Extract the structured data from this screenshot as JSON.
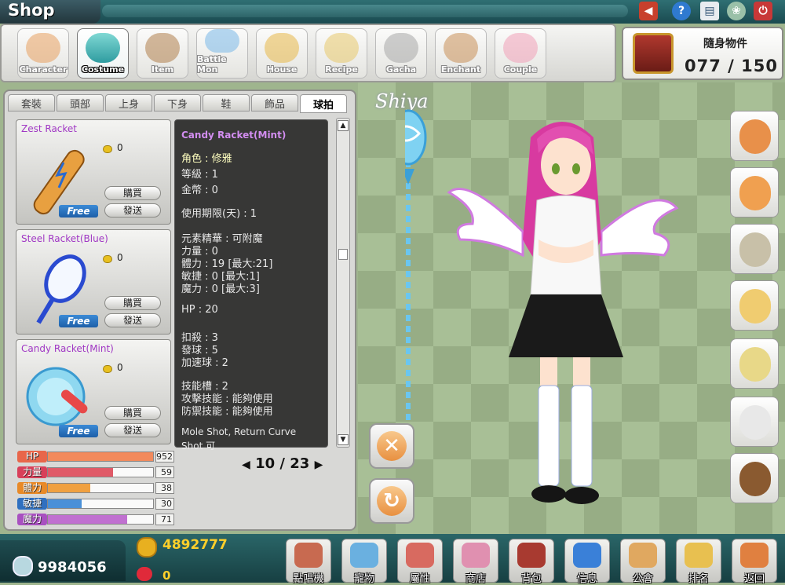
{
  "window": {
    "title": "Shop"
  },
  "system_icons": [
    "megaphone-icon",
    "help-icon",
    "paper-icon",
    "leaf-icon",
    "power-icon"
  ],
  "categories": [
    {
      "label": "Character",
      "icon": "character-art",
      "active": false
    },
    {
      "label": "Costume",
      "icon": "costume-art",
      "active": true
    },
    {
      "label": "Item",
      "icon": "boots-art",
      "active": false
    },
    {
      "label": "Battle Mon",
      "icon": "battle-mon-art",
      "active": false
    },
    {
      "label": "House",
      "icon": "house-art",
      "active": false
    },
    {
      "label": "Recipe",
      "icon": "recipe-scroll-art",
      "active": false
    },
    {
      "label": "Gacha",
      "icon": "gacha-machine-art",
      "active": false
    },
    {
      "label": "Enchant",
      "icon": "enchant-hut-art",
      "active": false
    },
    {
      "label": "Couple",
      "icon": "couple-hearts-art",
      "active": false
    }
  ],
  "inventory": {
    "label": "隨身物件",
    "count": "077 / 150"
  },
  "sub_tabs": [
    {
      "label": "套裝",
      "active": false
    },
    {
      "label": "頭部",
      "active": false
    },
    {
      "label": "上身",
      "active": false
    },
    {
      "label": "下身",
      "active": false
    },
    {
      "label": "鞋",
      "active": false
    },
    {
      "label": "飾品",
      "active": false
    },
    {
      "label": "球拍",
      "active": true
    }
  ],
  "items": [
    {
      "name": "Zest Racket",
      "price": "0",
      "badge": "Free",
      "buy": "購買",
      "gift": "發送",
      "art": "orange-racket"
    },
    {
      "name": "Steel Racket(Blue)",
      "price": "0",
      "badge": "Free",
      "buy": "購買",
      "gift": "發送",
      "art": "blue-tennis-racket"
    },
    {
      "name": "Candy Racket(Mint)",
      "price": "0",
      "badge": "Free",
      "buy": "購買",
      "gift": "發送",
      "art": "mint-candy-racket"
    }
  ],
  "tooltip": {
    "title": "Candy Racket(Mint)",
    "lines": [
      "角色 : 修雅",
      "等級 : 1",
      "金幣 : 0",
      "使用期限(天) : 1",
      "元素精華 : 可附魔",
      "力量 : 0",
      "體力 : 19 [最大:21]",
      "敏捷 : 0 [最大:1]",
      "魔力 : 0 [最大:3]",
      "HP : 20",
      "扣殺 : 3",
      "發球 : 5",
      "加速球 : 2",
      "技能槽 : 2",
      "攻擊技能 : 能夠使用",
      "防禦技能 : 能夠使用",
      "Mole Shot, Return Curve",
      "Shot 可"
    ]
  },
  "stats": [
    {
      "label": "HP",
      "value": "952",
      "fill": 1.0,
      "color": "#f28a5c",
      "label_bg": "#e8664a"
    },
    {
      "label": "力量",
      "value": "59",
      "fill": 0.62,
      "color": "#e05a68",
      "label_bg": "#d8405a"
    },
    {
      "label": "體力",
      "value": "38",
      "fill": 0.4,
      "color": "#f0a040",
      "label_bg": "#e88a28"
    },
    {
      "label": "敏捷",
      "value": "30",
      "fill": 0.32,
      "color": "#4a90d8",
      "label_bg": "#2f70c0"
    },
    {
      "label": "魔力",
      "value": "71",
      "fill": 0.75,
      "color": "#c070d0",
      "label_bg": "#a850c0"
    }
  ],
  "pager": {
    "current": "10",
    "total": "23"
  },
  "stage": {
    "character_name": "Shiya",
    "cancel_icon": "x-icon",
    "rotate_icon": "rotate-icon",
    "faces": [
      "face-boy-orange",
      "face-girl-orange",
      "face-girl-silver",
      "face-girl-blonde",
      "face-elf-blonde",
      "face-girl-white",
      "face-boy-dark"
    ]
  },
  "wallet": {
    "gems": "9984056",
    "gold": "4892777",
    "hearts": "0"
  },
  "bottom_menu": [
    {
      "label": "點唱機",
      "icon": "jukebox-icon"
    },
    {
      "label": "寵物",
      "icon": "pet-icon"
    },
    {
      "label": "屬性",
      "icon": "attribute-icon"
    },
    {
      "label": "商店",
      "icon": "shop-icon"
    },
    {
      "label": "背包",
      "icon": "backpack-icon"
    },
    {
      "label": "信息",
      "icon": "message-icon"
    },
    {
      "label": "公會",
      "icon": "guild-icon"
    },
    {
      "label": "排名",
      "icon": "ranking-icon"
    },
    {
      "label": "返回",
      "icon": "exit-door-icon"
    }
  ]
}
